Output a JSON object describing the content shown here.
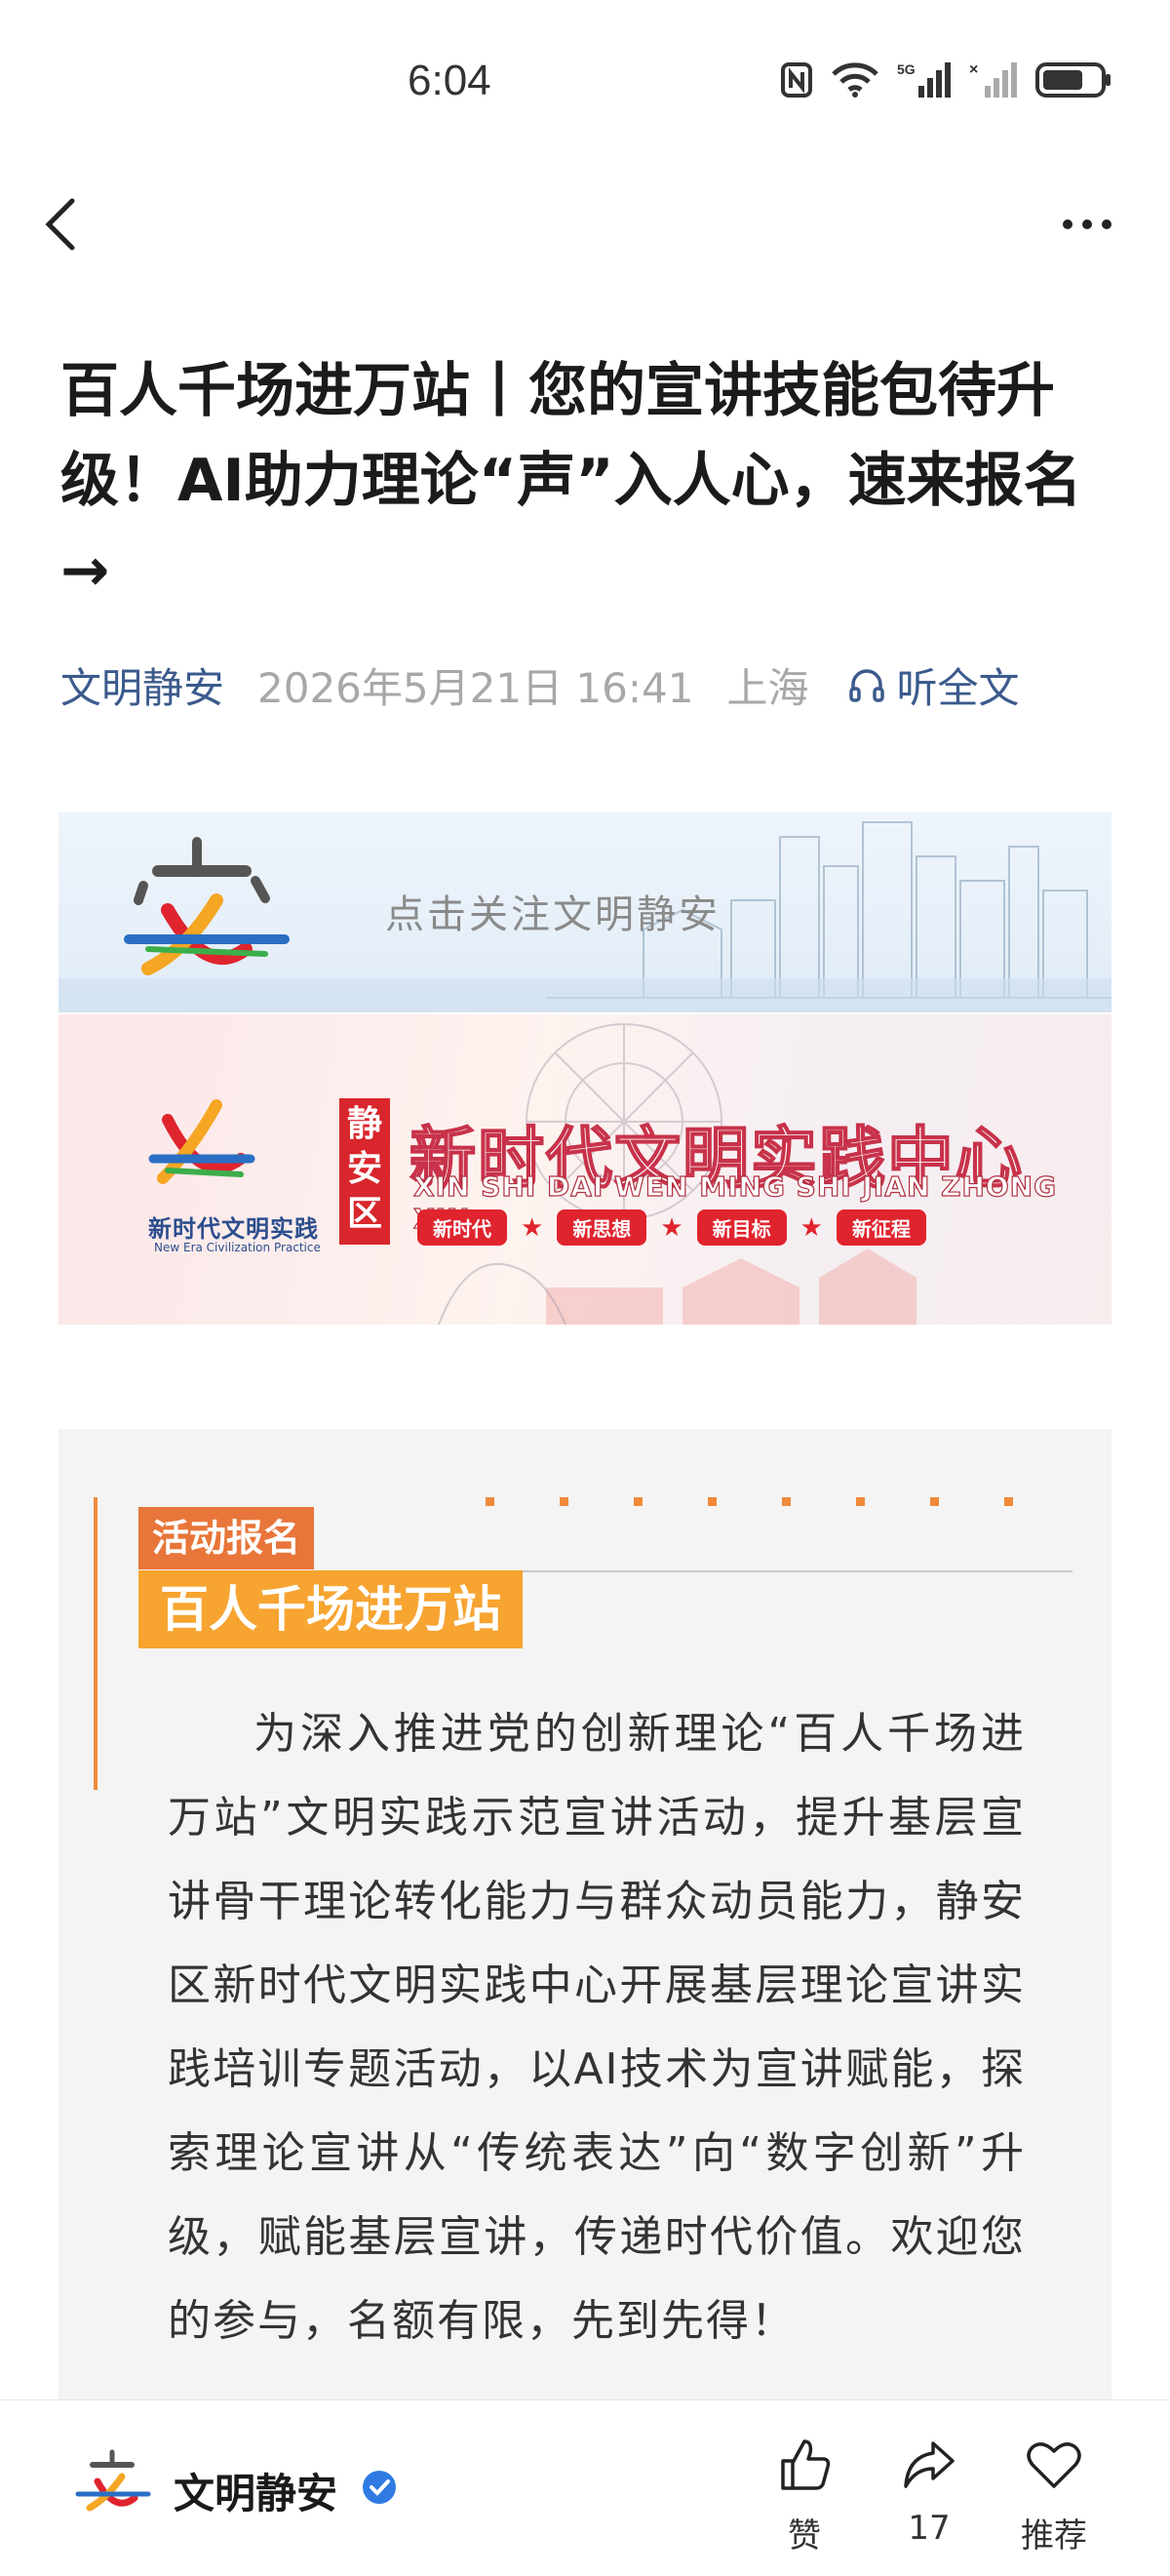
{
  "status_bar": {
    "time": "6:04",
    "network": "5G"
  },
  "nav": {
    "back": "back",
    "more": "more"
  },
  "article": {
    "title": "百人千场进万站丨您的宣讲技能包待升级！AI助力理论“声”入人心，速来报名→",
    "author": "文明静安",
    "date": "2026年5月21日 16:41",
    "location": "上海",
    "listen": "听全文"
  },
  "banner_follow": {
    "logo_text": "安",
    "text": "点击关注文明静安"
  },
  "banner_center": {
    "logo_caption": "新时代文明实践",
    "logo_caption_en": "New Era Civilization Practice",
    "district": "静安区",
    "title": "新时代文明实践中心",
    "pinyin": "XIN SHI DAI WEN MING SHI JIAN ZHONG XIN",
    "tags": [
      "新时代",
      "新思想",
      "新目标",
      "新征程"
    ]
  },
  "card": {
    "label": "活动报名",
    "heading": "百人千场进万站",
    "paragraph": "为深入推进党的创新理论“百人千场进万站”文明实践示范宣讲活动，提升基层宣讲骨干理论转化能力与群众动员能力，静安区新时代文明实践中心开展基层理论宣讲实践培训专题活动，以AI技术为宣讲赋能，探索理论宣讲从“传统表达”向“数字创新”升级，赋能基层宣讲，传递时代价值。欢迎您的参与，名额有限，先到先得！"
  },
  "bottom_bar": {
    "account_name": "文明静安",
    "like_label": "赞",
    "share_count": "17",
    "recommend_label": "推荐"
  },
  "colors": {
    "accent_blue": "#3b5a8c",
    "orange": "#e8763a",
    "amber": "#f7a431",
    "red": "#d8262c"
  }
}
